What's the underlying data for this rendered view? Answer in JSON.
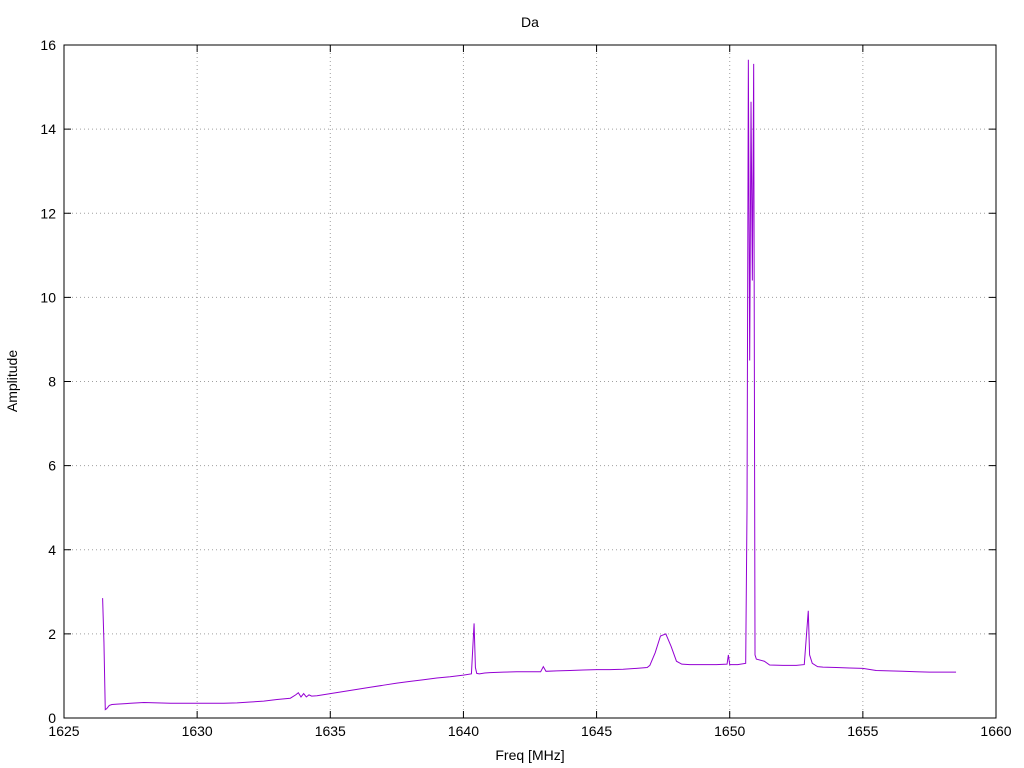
{
  "chart_data": {
    "type": "line",
    "title": "Da",
    "xlabel": "Freq [MHz]",
    "ylabel": "Amplitude",
    "xlim": [
      1625,
      1660
    ],
    "ylim": [
      0,
      16
    ],
    "xticks": [
      1625,
      1630,
      1635,
      1640,
      1645,
      1650,
      1655,
      1660
    ],
    "yticks": [
      0,
      2,
      4,
      6,
      8,
      10,
      12,
      14,
      16
    ],
    "grid": true,
    "series": [
      {
        "color": "#9400d3",
        "x": [
          1626.45,
          1626.5,
          1626.55,
          1626.6,
          1626.7,
          1626.8,
          1627.0,
          1627.5,
          1628.0,
          1628.5,
          1629.0,
          1629.5,
          1630.0,
          1630.5,
          1631.0,
          1631.5,
          1632.0,
          1632.5,
          1633.0,
          1633.5,
          1633.7,
          1633.8,
          1633.9,
          1634.0,
          1634.1,
          1634.2,
          1634.3,
          1634.5,
          1635.0,
          1635.5,
          1636.0,
          1636.5,
          1637.0,
          1637.5,
          1638.0,
          1638.5,
          1639.0,
          1639.5,
          1640.0,
          1640.3,
          1640.4,
          1640.45,
          1640.5,
          1640.6,
          1640.8,
          1641.0,
          1641.5,
          1642.0,
          1642.5,
          1642.9,
          1643.0,
          1643.1,
          1643.5,
          1644.0,
          1644.5,
          1645.0,
          1645.5,
          1646.0,
          1646.5,
          1646.9,
          1647.0,
          1647.2,
          1647.4,
          1647.6,
          1647.8,
          1648.0,
          1648.2,
          1648.5,
          1649.0,
          1649.5,
          1649.9,
          1649.95,
          1650.0,
          1650.3,
          1650.6,
          1650.65,
          1650.7,
          1650.75,
          1650.8,
          1650.85,
          1650.9,
          1650.95,
          1651.0,
          1651.3,
          1651.5,
          1652.0,
          1652.5,
          1652.8,
          1652.95,
          1653.0,
          1653.1,
          1653.3,
          1653.5,
          1654.0,
          1654.5,
          1655.0,
          1655.5,
          1656.0,
          1656.5,
          1657.0,
          1657.5,
          1658.0,
          1658.5
        ],
        "y": [
          2.85,
          1.8,
          0.2,
          0.22,
          0.3,
          0.32,
          0.33,
          0.35,
          0.37,
          0.36,
          0.35,
          0.35,
          0.35,
          0.35,
          0.35,
          0.36,
          0.38,
          0.4,
          0.44,
          0.47,
          0.55,
          0.6,
          0.5,
          0.58,
          0.5,
          0.55,
          0.52,
          0.53,
          0.58,
          0.63,
          0.68,
          0.73,
          0.78,
          0.83,
          0.87,
          0.91,
          0.95,
          0.98,
          1.02,
          1.05,
          2.25,
          1.2,
          1.06,
          1.05,
          1.07,
          1.08,
          1.09,
          1.1,
          1.1,
          1.1,
          1.22,
          1.11,
          1.12,
          1.13,
          1.14,
          1.15,
          1.15,
          1.16,
          1.18,
          1.2,
          1.25,
          1.55,
          1.95,
          2.0,
          1.7,
          1.35,
          1.28,
          1.27,
          1.27,
          1.27,
          1.28,
          1.5,
          1.27,
          1.27,
          1.3,
          5.0,
          15.65,
          8.5,
          14.65,
          10.4,
          15.55,
          1.5,
          1.4,
          1.35,
          1.26,
          1.25,
          1.25,
          1.27,
          2.55,
          1.5,
          1.3,
          1.22,
          1.21,
          1.2,
          1.19,
          1.18,
          1.13,
          1.12,
          1.11,
          1.1,
          1.09,
          1.09,
          1.09
        ]
      }
    ]
  }
}
